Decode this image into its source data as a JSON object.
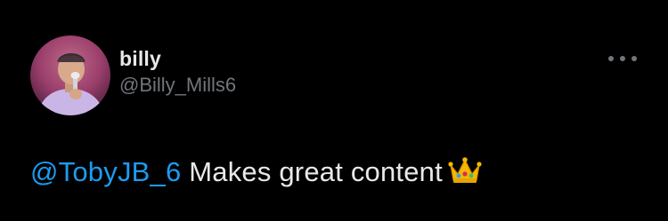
{
  "author": {
    "display_name": "billy",
    "handle": "@Billy_Mills6",
    "avatar_icon": "profile-photo-avatar"
  },
  "more_menu": {
    "icon": "more-horizontal-icon"
  },
  "tweet": {
    "mention": "@TobyJB_6",
    "text": " Makes great content",
    "emoji_icon": "crown-emoji-icon"
  },
  "colors": {
    "background": "#000000",
    "primary_text": "#e7e9ea",
    "secondary_text": "#71767b",
    "link": "#1d9bf0"
  }
}
